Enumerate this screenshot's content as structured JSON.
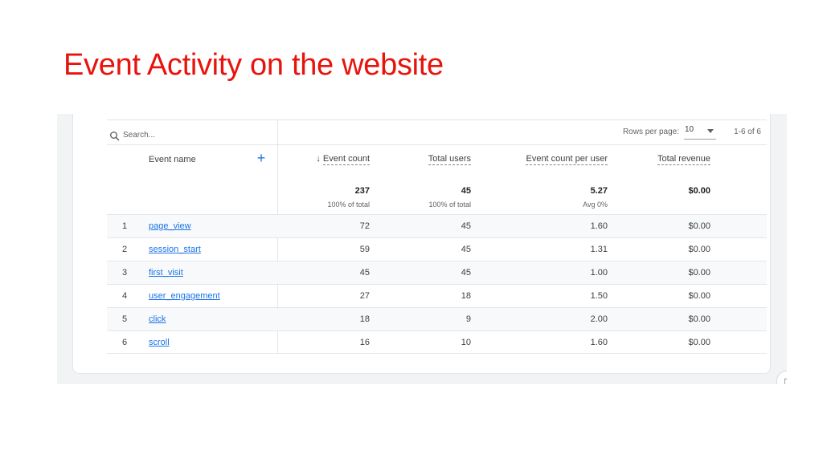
{
  "slide": {
    "title": "Event Activity on the website"
  },
  "toolbar": {
    "search_placeholder": "Search...",
    "rows_per_page_label": "Rows per page:",
    "rows_per_page_value": "10",
    "range_text": "1-6 of 6"
  },
  "table": {
    "columns": {
      "event_name": "Event name",
      "event_count": "Event count",
      "total_users": "Total users",
      "event_count_per_user": "Event count per user",
      "total_revenue": "Total revenue"
    },
    "totals": {
      "event_count": "237",
      "event_count_sub": "100% of total",
      "total_users": "45",
      "total_users_sub": "100% of total",
      "event_count_per_user": "5.27",
      "event_count_per_user_sub": "Avg 0%",
      "total_revenue": "$0.00"
    },
    "rows": [
      {
        "index": "1",
        "event_name": "page_view",
        "event_count": "72",
        "total_users": "45",
        "per_user": "1.60",
        "revenue": "$0.00"
      },
      {
        "index": "2",
        "event_name": "session_start",
        "event_count": "59",
        "total_users": "45",
        "per_user": "1.31",
        "revenue": "$0.00"
      },
      {
        "index": "3",
        "event_name": "first_visit",
        "event_count": "45",
        "total_users": "45",
        "per_user": "1.00",
        "revenue": "$0.00"
      },
      {
        "index": "4",
        "event_name": "user_engagement",
        "event_count": "27",
        "total_users": "18",
        "per_user": "1.50",
        "revenue": "$0.00"
      },
      {
        "index": "5",
        "event_name": "click",
        "event_count": "18",
        "total_users": "9",
        "per_user": "2.00",
        "revenue": "$0.00"
      },
      {
        "index": "6",
        "event_name": "scroll",
        "event_count": "16",
        "total_users": "10",
        "per_user": "1.60",
        "revenue": "$0.00"
      }
    ]
  },
  "icons": {
    "search": "search-icon",
    "sort": "arrow-down-icon",
    "add": "plus-icon",
    "dropdown": "caret-down-icon",
    "corner": "feedback-icon"
  },
  "colors": {
    "title": "#e8130c",
    "link": "#1a73e8",
    "add": "#1a73e8"
  }
}
